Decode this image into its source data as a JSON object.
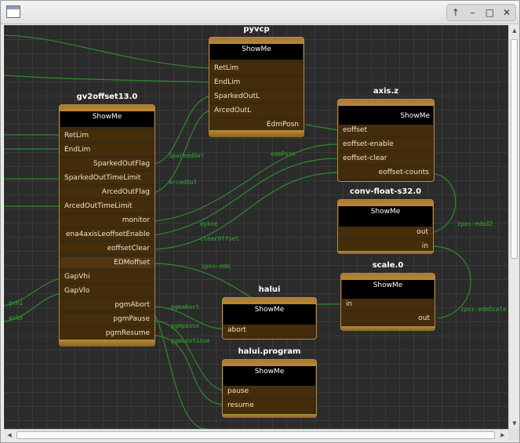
{
  "window": {
    "title": "",
    "controls": {
      "up": "↑",
      "minimize": "–",
      "maximize": "□",
      "close": "✕"
    }
  },
  "nodes": {
    "pyvcp": {
      "title": "pyvcp",
      "showme": "ShowMe",
      "ports": [
        "RetLim",
        "EndLim",
        "SparkedOutL",
        "ArcedOutL",
        "EdmPosn"
      ]
    },
    "gv2offset": {
      "title": "gv2offset13.0",
      "showme": "ShowMe",
      "ports": [
        "RetLim",
        "EndLim",
        "SparkedOutFlag",
        "SparkedOutTimeLimit",
        "ArcedOutFlag",
        "ArcedOutTimeLimit",
        "monitor",
        "ena4axisLeoffsetEnable",
        "eoffsetClear",
        "EDMoffset",
        "GapVhi",
        "GapVlo",
        "pgmAbort",
        "pgmPause",
        "pgmResume"
      ]
    },
    "axisz": {
      "title": "axis.z",
      "showme": "ShowMe",
      "ports": [
        "eoffset",
        "eoffset-enable",
        "eoffset-clear",
        "eoffset-counts"
      ]
    },
    "convfloat": {
      "title": "conv-float-s32.0",
      "showme": "ShowMe",
      "ports": [
        "out",
        "in"
      ]
    },
    "scale": {
      "title": "scale.0",
      "showme": "ShowMe",
      "ports": [
        "in",
        "out"
      ]
    },
    "halui": {
      "title": "halui",
      "showme": "ShowMe",
      "ports": [
        "abort"
      ]
    },
    "haluiprogram": {
      "title": "halui.program",
      "showme": "ShowMe",
      "ports": [
        "pause",
        "resume"
      ]
    }
  },
  "signals": {
    "sparkedout": "SparkedOut",
    "arcedout": "ArcedOut",
    "edmposn": "edmPosn",
    "zpos_edm_top": "zpos-edm",
    "eoffset_enable": "mykne",
    "clear_offset": "clearOffset",
    "zpos_edm": "zpos-edm",
    "zpos_edm32": "zpos-edm32",
    "zpos_edmscale": "zpos-edmScale",
    "pgmabort": "pgmabort",
    "pgmpause": "pgmpause",
    "pgmcontinue": "pgmcontinue",
    "gvhi": "gvhi",
    "gvlo": "gvlo"
  },
  "colors": {
    "canvas": "#2b2b2b",
    "wire": "#2d8a2d",
    "node_border": "#b98a3a",
    "port_bg": "#452d0c"
  }
}
